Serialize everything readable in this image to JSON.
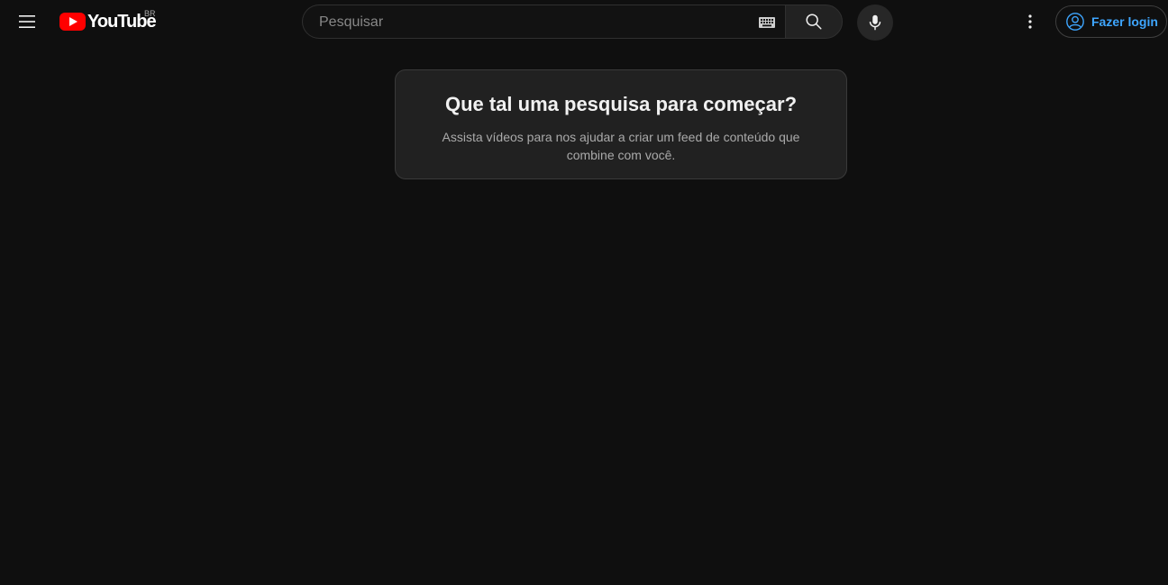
{
  "header": {
    "logo_text": "YouTube",
    "region": "BR",
    "search_placeholder": "Pesquisar",
    "login_label": "Fazer login"
  },
  "prompt": {
    "title": "Que tal uma pesquisa para começar?",
    "text": "Assista vídeos para nos ajudar a criar um feed de conteúdo que combine com você."
  },
  "icons": {
    "menu": "menu-icon",
    "logo": "youtube-logo-icon",
    "keyboard": "keyboard-icon",
    "search": "search-icon",
    "mic": "mic-icon",
    "more": "more-vert-icon",
    "account": "account-circle-icon"
  },
  "colors": {
    "background": "#0f0f0f",
    "brand_red": "#ff0000",
    "link_blue": "#3ea6ff",
    "card_bg": "#212121"
  }
}
